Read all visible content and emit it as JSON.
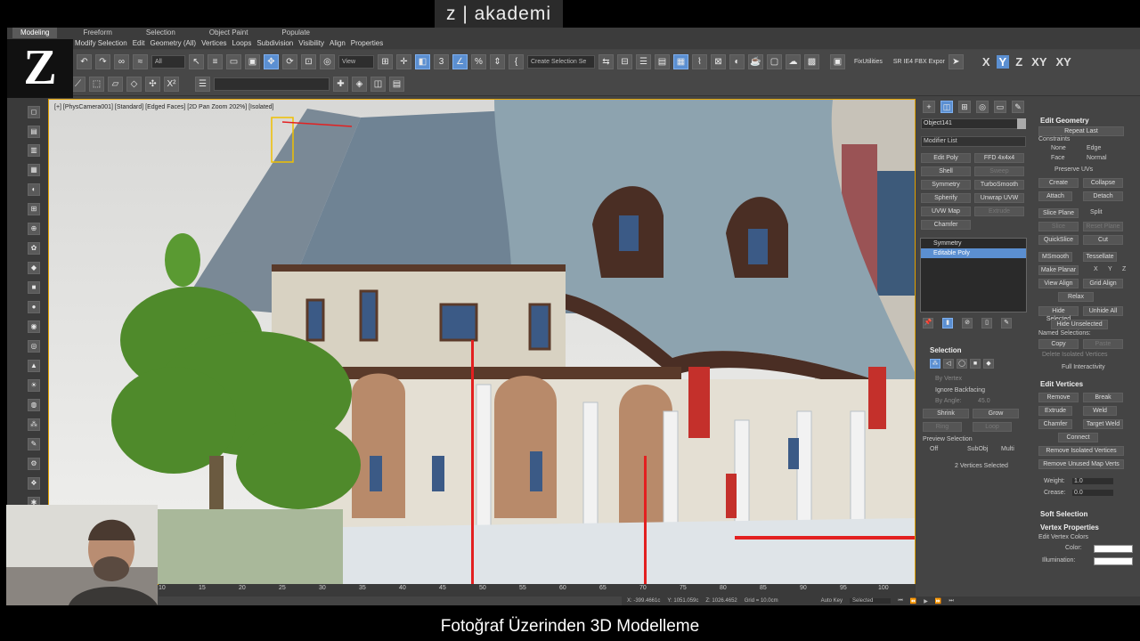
{
  "brand": "z | akademi",
  "ribbon": {
    "tabs": [
      "Modeling",
      "Freeform",
      "Selection",
      "Object Paint",
      "Populate"
    ],
    "sub": [
      "Modify Selection",
      "Edit",
      "Geometry (All)",
      "Vertices",
      "Loops",
      "Subdivision",
      "Visibility",
      "Align",
      "Properties"
    ]
  },
  "toolbar": {
    "filter": "All",
    "view": "View",
    "selset": "Create Selection Se",
    "fx": "FixUtilities",
    "sr": "SR IE4 FBX Expor",
    "axes": [
      "X",
      "Y",
      "Z",
      "XY",
      "XY"
    ]
  },
  "viewport": {
    "label": "[+] [PhysCamera001] [Standard] [Edged Faces] [2D Pan Zoom 202%] [Isolated]"
  },
  "command": {
    "object_name": "Object141",
    "modifier_list": "Modifier List",
    "buttons": [
      "Edit Poly",
      "FFD 4x4x4",
      "Shell",
      "Sweep",
      "Symmetry",
      "TurboSmooth",
      "Spherify",
      "Unwrap UVW",
      "UVW Map",
      "Extrude",
      "Chamfer"
    ],
    "stack": [
      "Symmetry",
      "Editable Poly"
    ],
    "selection": {
      "title": "Selection",
      "by_vertex": "By Vertex",
      "ignore_backfacing": "Ignore Backfacing",
      "by_angle": "By Angle:",
      "angle": "45.0",
      "shrink": "Shrink",
      "grow": "Grow",
      "ring": "Ring",
      "loop": "Loop",
      "preview": "Preview Selection",
      "off": "Off",
      "subobj": "SubObj",
      "multi": "Multi",
      "status": "2 Vertices Selected"
    }
  },
  "props": {
    "edit_geometry": "Edit Geometry",
    "repeat_last": "Repeat Last",
    "constraints": "Constraints",
    "none": "None",
    "edge": "Edge",
    "face": "Face",
    "normal": "Normal",
    "preserve_uvs": "Preserve UVs",
    "create": "Create",
    "collapse": "Collapse",
    "attach": "Attach",
    "detach": "Detach",
    "slice_plane": "Slice Plane",
    "split": "Split",
    "slice": "Slice",
    "reset_plane": "Reset Plane",
    "quickslice": "QuickSlice",
    "cut": "Cut",
    "msmooth": "MSmooth",
    "tessellate": "Tessellate",
    "make_planar": "Make Planar",
    "x": "X",
    "y": "Y",
    "z": "Z",
    "view_align": "View Align",
    "grid_align": "Grid Align",
    "relax": "Relax",
    "hide_selected": "Hide Selected",
    "unhide_all": "Unhide All",
    "hide_unselected": "Hide Unselected",
    "named_selections": "Named Selections:",
    "copy": "Copy",
    "paste": "Paste",
    "delete_isolated": "Delete Isolated Vertices",
    "full_interactivity": "Full Interactivity",
    "edit_vertices": "Edit Vertices",
    "remove": "Remove",
    "break": "Break",
    "extrude": "Extrude",
    "weld": "Weld",
    "chamfer": "Chamfer",
    "target_weld": "Target Weld",
    "connect": "Connect",
    "remove_isolated": "Remove Isolated Vertices",
    "remove_unused": "Remove Unused Map Verts",
    "weight_label": "Weight:",
    "weight": "1.0",
    "crease_label": "Crease:",
    "crease": "0.0",
    "soft_selection": "Soft Selection",
    "vertex_properties": "Vertex Properties",
    "edit_vertex_colors": "Edit Vertex Colors",
    "color": "Color:",
    "illumination": "Illumination:"
  },
  "timeline": {
    "ticks": [
      "10",
      "15",
      "20",
      "25",
      "30",
      "35",
      "40",
      "45",
      "50",
      "55",
      "60",
      "65",
      "70",
      "75",
      "80",
      "85",
      "90",
      "95",
      "100"
    ]
  },
  "status": {
    "x": "X: -399.4661c",
    "y": "Y: 1051.059c",
    "z": "Z: 1026.4652",
    "grid": "Grid = 10.0cm",
    "autokey": "Auto Key",
    "selected": "Selected"
  },
  "caption": "Fotoğraf Üzerinden 3D Modelleme",
  "colors": {
    "accent": "#5b8fd1",
    "roof": "#8aa0ab",
    "wood": "#5a3a2a",
    "banner": "#c4302b",
    "tree": "#4f8a2b"
  }
}
